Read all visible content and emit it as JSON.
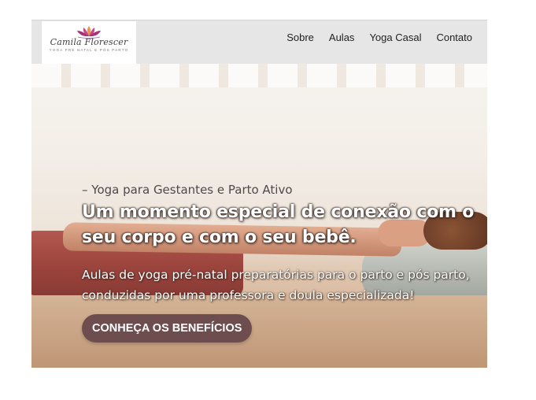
{
  "brand": {
    "name": "Camila Florescer",
    "tagline": "YOGA PRÉ NATAL E PÓS PARTO"
  },
  "nav": {
    "items": [
      {
        "label": "Sobre"
      },
      {
        "label": "Aulas"
      },
      {
        "label": "Yoga Casal"
      },
      {
        "label": "Contato"
      }
    ]
  },
  "hero": {
    "kicker": "– Yoga para Gestantes e Parto Ativo",
    "headline": "Um momento especial de conexão com o seu corpo e com o seu bebê.",
    "subtext": "Aulas de yoga pré-natal preparatórias para o parto e pós parto, conduzidas por uma professora e doula especializada!",
    "cta_label": "CONHEÇA OS BENEFÍCIOS"
  },
  "colors": {
    "header_bg": "#e6e6e6",
    "cta_bg": "#6e4d4f",
    "lotus_pink": "#c4478f",
    "lotus_orange": "#e9964a"
  },
  "icons": {
    "logo": "lotus-icon"
  }
}
